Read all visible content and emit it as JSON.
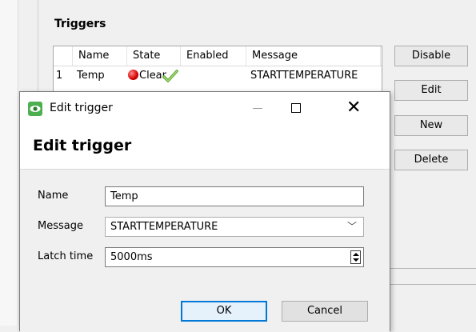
{
  "triggers_section": {
    "title": "Triggers",
    "columns": [
      "Name",
      "State",
      "Enabled",
      "Message"
    ],
    "rows": [
      {
        "index": "1",
        "name": "Temp",
        "state": "Clear",
        "enabled": true,
        "message": "STARTTEMPERATURE"
      }
    ]
  },
  "side_buttons": {
    "disable": "Disable",
    "edit": "Edit",
    "new": "New",
    "delete": "Delete"
  },
  "dialog": {
    "window_title": "Edit trigger",
    "heading": "Edit trigger",
    "fields": {
      "name_label": "Name",
      "name_value": "Temp",
      "message_label": "Message",
      "message_value": "STARTTEMPERATURE",
      "latch_label": "Latch time",
      "latch_value": "5000ms"
    },
    "ok_label": "OK",
    "cancel_label": "Cancel"
  },
  "colors": {
    "accent": "#0078d7",
    "state_clear": "#d40000",
    "check": "#7cc242",
    "app_icon": "#4caf50"
  }
}
